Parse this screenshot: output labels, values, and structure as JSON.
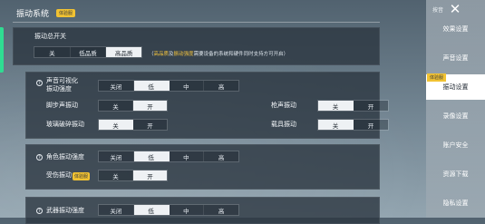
{
  "header": {
    "title": "振动系统",
    "badge": "体验服"
  },
  "master": {
    "label": "振动总开关",
    "options": [
      "关",
      "低品质",
      "高品质"
    ],
    "selected": 2,
    "note": {
      "open": "（",
      "hl1": "高品质",
      "mid1": "及",
      "hl2": "振动强度",
      "rest": "需要设备的系统和硬件同时支持方可开启）"
    }
  },
  "sound": {
    "label1": "声音可视化",
    "label2": "振动强度",
    "options": [
      "关闭",
      "低",
      "中",
      "高"
    ],
    "selected": 1
  },
  "footstep": {
    "label": "脚步声振动",
    "options": [
      "关",
      "开"
    ],
    "selected": 1
  },
  "gunshot": {
    "label": "枪声振动",
    "options": [
      "关",
      "开"
    ],
    "selected": 0
  },
  "glass": {
    "label": "玻璃破碎振动",
    "options": [
      "关",
      "开"
    ],
    "selected": 0
  },
  "vehicle": {
    "label": "载具振动",
    "options": [
      "关",
      "开"
    ],
    "selected": 0
  },
  "role": {
    "label": "角色振动强度",
    "options": [
      "关闭",
      "低",
      "中",
      "高"
    ],
    "selected": 1
  },
  "hurt": {
    "label": "受伤振动",
    "badge": "体验服",
    "options": [
      "关",
      "开"
    ],
    "selected": 1
  },
  "partial": {
    "label": "武器振动强度",
    "options": [
      "关闭",
      "低",
      "中",
      "高"
    ],
    "selected": 1
  },
  "sidebar": {
    "top_label": "按音",
    "close_icon": "close-icon",
    "items": [
      {
        "label": "效果设置"
      },
      {
        "label": "声音设置"
      },
      {
        "label": "振动设置",
        "badge": "体验服"
      },
      {
        "label": "录像设置"
      },
      {
        "label": "账户安全"
      },
      {
        "label": "资源下载"
      },
      {
        "label": "隐私设置"
      }
    ],
    "active": 2
  }
}
